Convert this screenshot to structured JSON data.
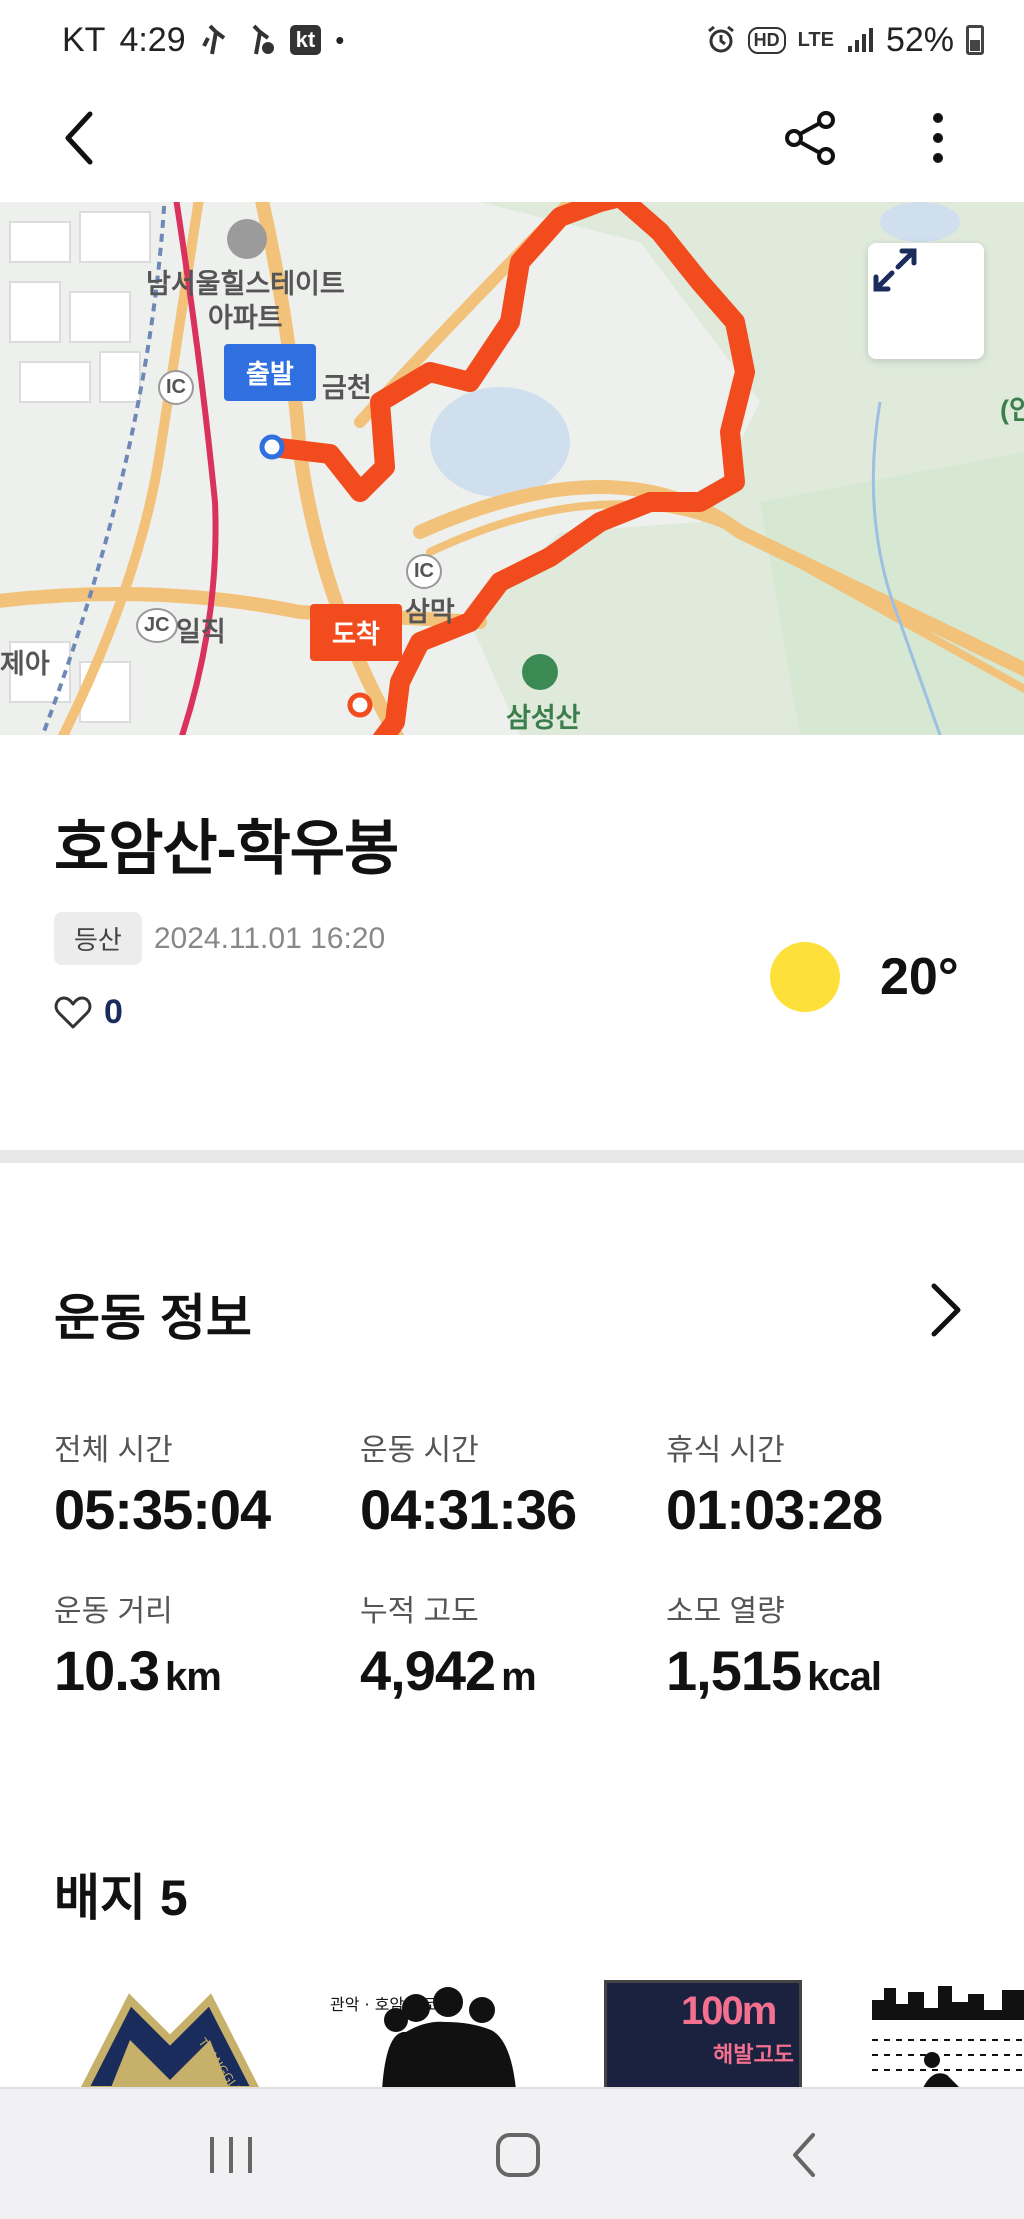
{
  "status_bar": {
    "carrier": "KT",
    "time": "4:29",
    "kt_badge": "kt",
    "dot": "•",
    "hd": "HD",
    "lte": "LTE",
    "battery": "52%"
  },
  "map": {
    "labels": {
      "apartment_line1": "남서울힐스테이트",
      "apartment_line2": "아파트",
      "geumcheon": "금천",
      "ic1": "IC",
      "ic2": "IC",
      "jc": "JC",
      "iljik": "일직",
      "sammak": "삼막",
      "samseongsan": "삼성산",
      "edge_right": "(인",
      "edge_left": "제아"
    },
    "start_marker": "출발",
    "end_marker": "도착",
    "route_color": "#f24b1d"
  },
  "activity": {
    "title": "호암산-학우봉",
    "type_tag": "등산",
    "datetime": "2024.11.01 16:20",
    "likes": "0",
    "temperature": "20°"
  },
  "exercise_info": {
    "heading": "운동 정보",
    "stats": [
      {
        "label": "전체 시간",
        "value": "05:35:04",
        "unit": ""
      },
      {
        "label": "운동 시간",
        "value": "04:31:36",
        "unit": ""
      },
      {
        "label": "휴식 시간",
        "value": "01:03:28",
        "unit": ""
      },
      {
        "label": "운동 거리",
        "value": "10.3",
        "unit": "km"
      },
      {
        "label": "누적 고도",
        "value": "4,942",
        "unit": "m"
      },
      {
        "label": "소모 열량",
        "value": "1,515",
        "unit": "kcal"
      }
    ]
  },
  "badges": {
    "heading": "배지 5",
    "items": [
      {
        "name": "TRANGGLE",
        "text": "TRANGGLE"
      },
      {
        "name": "관악 호암산 코스3",
        "text": "관악 · 호암산 코스3"
      },
      {
        "name": "100m 해발고도",
        "value": "100m",
        "text": "해발고도"
      },
      {
        "name": "city skyline"
      }
    ]
  }
}
